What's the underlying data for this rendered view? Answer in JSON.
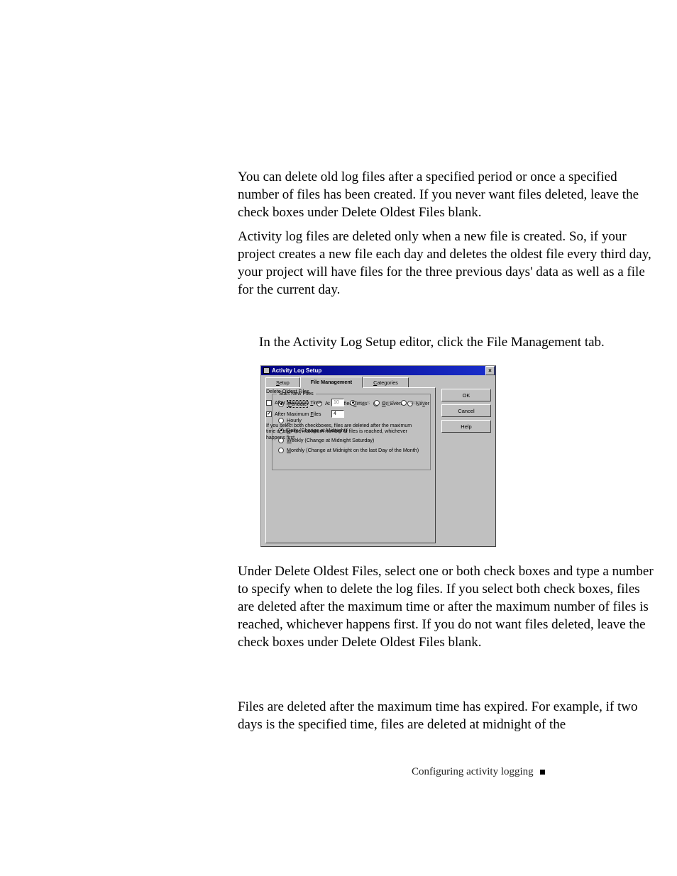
{
  "paragraphs": {
    "p1": "You can delete old log files after a specified period or once a specified number of files has been created. If you never want files deleted, leave the check boxes under Delete Oldest Files blank.",
    "p2": "Activity log files are deleted only when a new file is created. So, if your project creates a new file each day and deletes the oldest file every third day, your project will have files for the three previous days' data as well as a file for the current day.",
    "instruction": "In the Activity Log Setup editor, click the File Management tab.",
    "p3": "Under Delete Oldest Files, select one or both check boxes and type a number to specify when to delete the log files. If you select both check boxes, files are deleted after the maximum time or after the maximum number of files is reached, whichever happens first. If you do not want files deleted, leave the check boxes under Delete Oldest Files blank.",
    "p4": "Files are deleted after the maximum time has expired. For example, if two days is the specified time, files are deleted at midnight of the"
  },
  "footer": "Configuring activity logging",
  "dialog": {
    "title": "Activity Log Setup",
    "tabs": {
      "setup": "Setup",
      "file_management": "File Management",
      "categories": "Categories"
    },
    "buttons": {
      "ok": "OK",
      "cancel": "Cancel",
      "help": "Help"
    },
    "start_new_files": {
      "legend": "Start New Files",
      "periodic": "Periodic",
      "at_specified_times": "At Specified Times",
      "on_event": "On Event",
      "never": "Never",
      "hourly": "Hourly",
      "daily": "Daily (Change at Midnight)",
      "weekly": "Weekly (Change at Midnight Saturday)",
      "monthly": "Monthly (Change at Midnight on the last Day of the Month)"
    },
    "delete_oldest": {
      "legend": "Delete Oldest Files",
      "after_max_time": "After Maximum Time",
      "after_max_files": "After Maximum Files",
      "time_value": "10",
      "files_value": "4",
      "units": {
        "days": "Days",
        "weeks": "Weeks",
        "months": "Months"
      },
      "note": "If you select both checkboxes, files are deleted after the maximum time or after the maximum number of files is reached, whichever happens first."
    }
  }
}
